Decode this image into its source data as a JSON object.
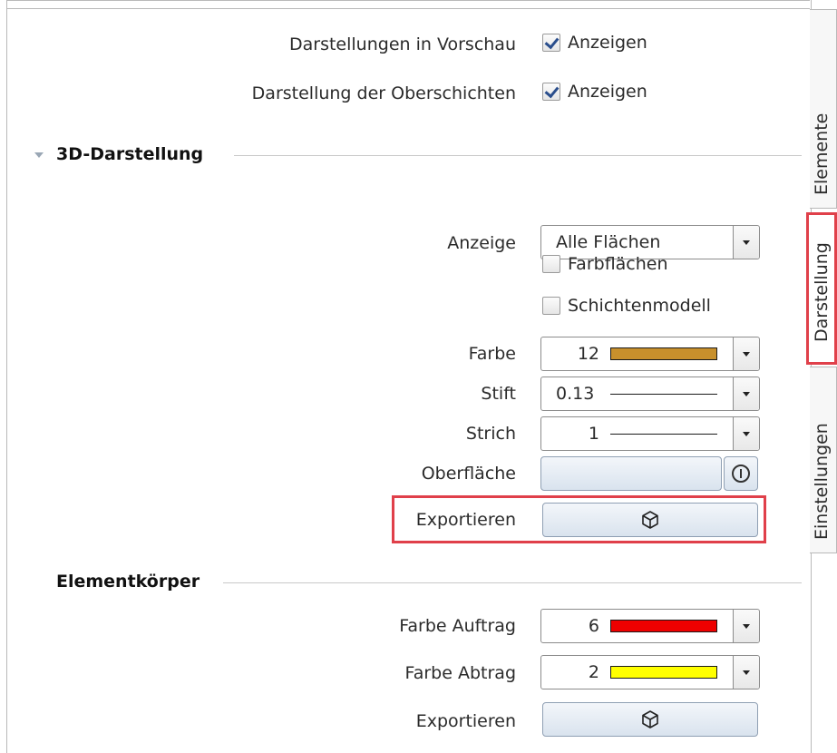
{
  "top_rows": [
    {
      "label": "Darstellungen in Vorschau",
      "checkbox_label": "Anzeigen",
      "checked": true
    },
    {
      "label": "Darstellung der Oberschichten",
      "checkbox_label": "Anzeigen",
      "checked": true
    }
  ],
  "section_3d": {
    "title": "3D-Darstellung",
    "anzeige": {
      "label": "Anzeige",
      "value": "Alle Flächen"
    },
    "farbflaechen": {
      "label": "Farbflächen",
      "checked": false
    },
    "schichtenmodell": {
      "label": "Schichtenmodell",
      "checked": false
    },
    "farbe": {
      "label": "Farbe",
      "value": "12",
      "color": "#c8902c"
    },
    "stift": {
      "label": "Stift",
      "value": "0.13"
    },
    "strich": {
      "label": "Strich",
      "value": "1"
    },
    "oberflaeche": {
      "label": "Oberfläche"
    },
    "exportieren": {
      "label": "Exportieren"
    }
  },
  "section_element": {
    "title": "Elementkörper",
    "farbe_auftrag": {
      "label": "Farbe Auftrag",
      "value": "6",
      "color": "#ee0000"
    },
    "farbe_abtrag": {
      "label": "Farbe Abtrag",
      "value": "2",
      "color": "#ffff00"
    },
    "exportieren": {
      "label": "Exportieren"
    }
  },
  "side_tabs": [
    {
      "label": "Elemente",
      "active": false
    },
    {
      "label": "Darstellung",
      "active": true
    },
    {
      "label": "Einstellungen",
      "active": false
    }
  ],
  "highlight_color": "#e0404a"
}
